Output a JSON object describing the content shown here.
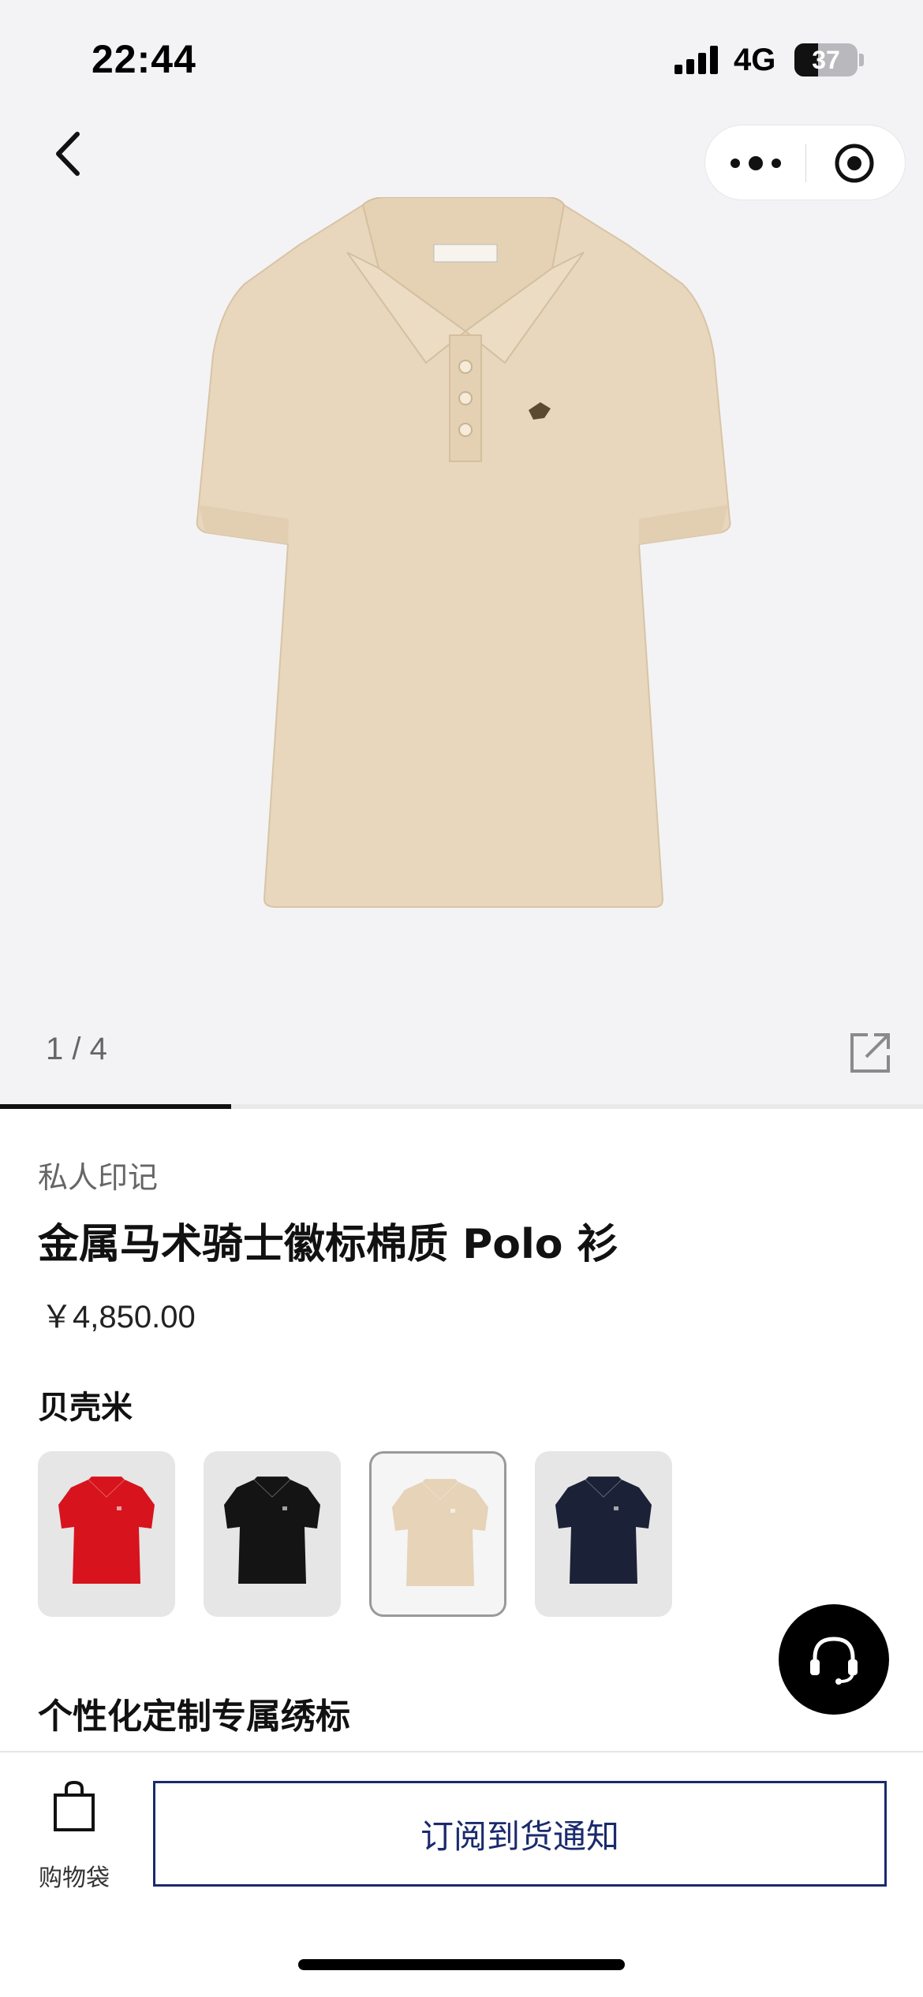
{
  "status_bar": {
    "time": "22:44",
    "network": "4G",
    "battery_percent": "37",
    "battery_level": 0.37
  },
  "nav": {
    "back_icon": "chevron-left-icon",
    "more_icon": "more-dots-icon",
    "target_icon": "target-icon"
  },
  "gallery": {
    "counter": "1 / 4",
    "current_index": 1,
    "total": 4,
    "share_icon": "share-icon",
    "shirt_color": "#e9d7bd"
  },
  "product": {
    "category": "私人印记",
    "title": "金属马术骑士徽标棉质 Polo 衫",
    "price": "￥4,850.00",
    "color_name": "贝壳米"
  },
  "swatches": [
    {
      "name": "red",
      "color": "#d7131d",
      "selected": false
    },
    {
      "name": "black",
      "color": "#141414",
      "selected": false
    },
    {
      "name": "shell-beige",
      "color": "#e6d3b8",
      "selected": true
    },
    {
      "name": "navy",
      "color": "#1b2136",
      "selected": false
    }
  ],
  "customization": {
    "title": "个性化定制专属绣标"
  },
  "support": {
    "icon": "headset-icon"
  },
  "bottom_bar": {
    "bag_label": "购物袋",
    "bag_icon": "shopping-bag-icon",
    "notify_label": "订阅到货通知"
  }
}
